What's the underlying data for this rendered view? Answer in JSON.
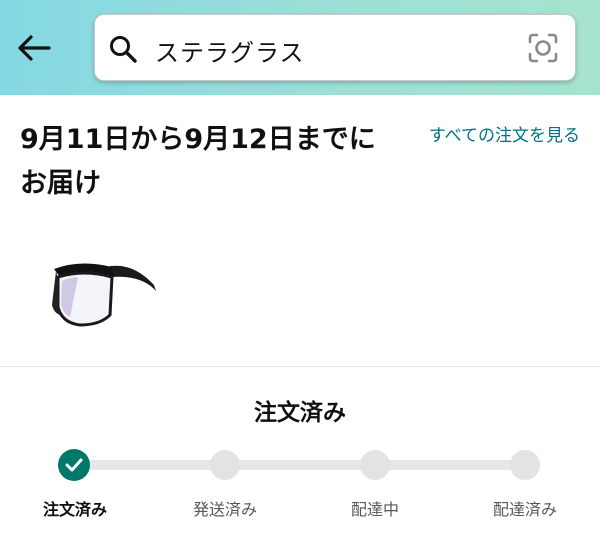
{
  "search": {
    "query": "ステラグラス"
  },
  "delivery": {
    "message": "9月11日から9月12日までにお届け",
    "see_all_link": "すべての注文を見る"
  },
  "status": {
    "title": "注文済み",
    "current_step": 0,
    "steps": [
      {
        "label": "注文済み"
      },
      {
        "label": "発送済み"
      },
      {
        "label": "配達中"
      },
      {
        "label": "配達済み"
      }
    ]
  },
  "colors": {
    "header_gradient_start": "#84d8e3",
    "header_gradient_end": "#a6e3cf",
    "link": "#007185",
    "progress_done": "#00796b",
    "progress_pending": "#e3e3e3"
  },
  "icons": {
    "back": "arrow-left-icon",
    "search": "search-icon",
    "camera": "camera-scan-icon",
    "check": "check-icon"
  }
}
